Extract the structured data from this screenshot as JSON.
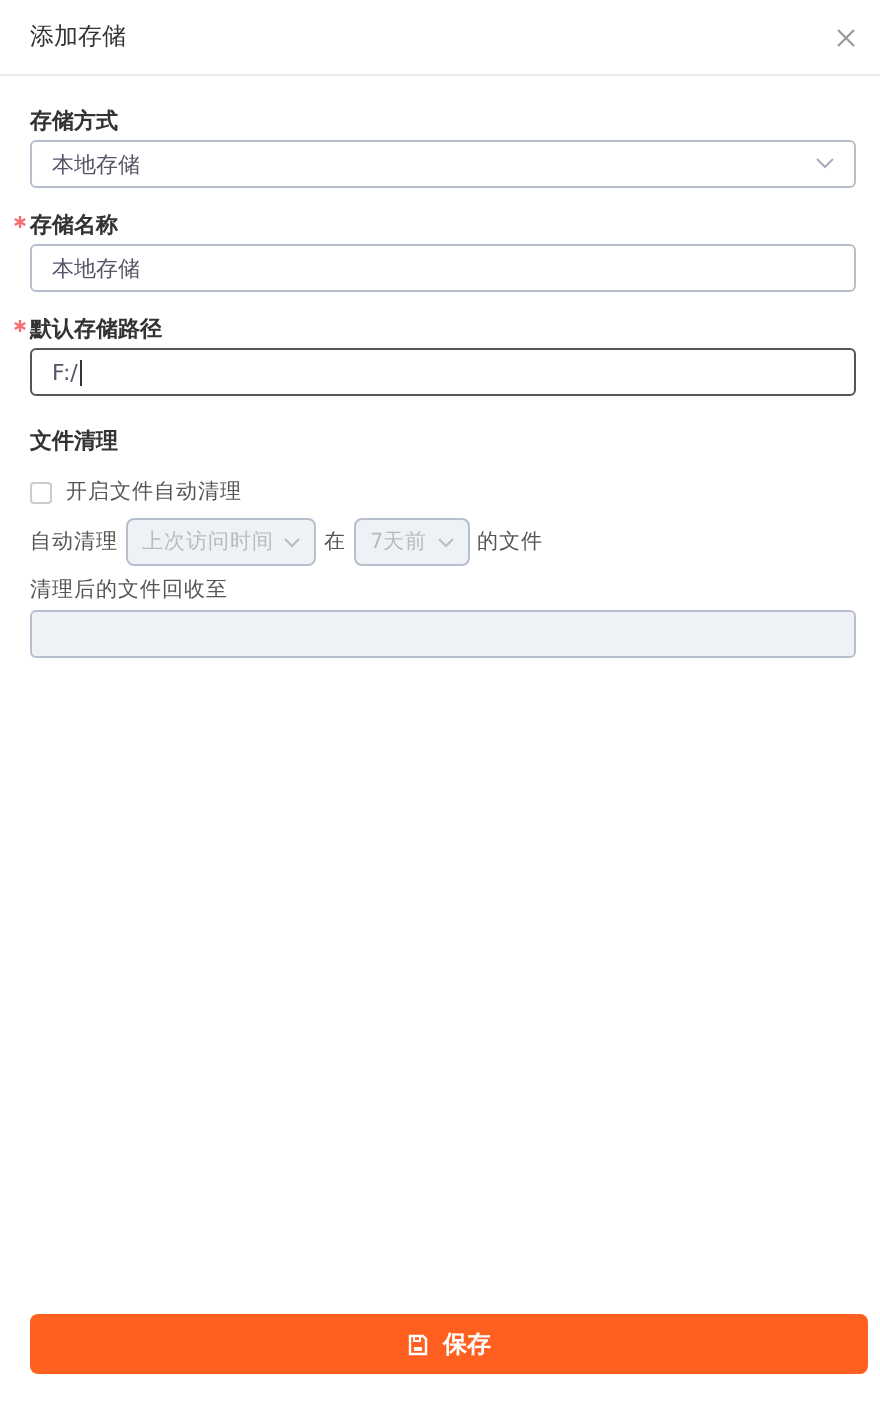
{
  "dialog": {
    "title": "添加存储"
  },
  "fields": [
    {
      "kind": "select",
      "label": "存储方式",
      "required": false,
      "value": "本地存储",
      "focused": false
    },
    {
      "kind": "input",
      "label": "存储名称",
      "required": true,
      "value": "本地存储",
      "focused": false
    },
    {
      "kind": "input",
      "label": "默认存储路径",
      "required": true,
      "value": "F:/",
      "focused": true
    }
  ],
  "cleanup": {
    "title": "文件清理",
    "checkbox": {
      "label": "开启文件自动清理",
      "checked": false
    },
    "rule": {
      "prefix": "自动清理",
      "time_select": "上次访问时间",
      "middle": "在",
      "age_select": "7天前",
      "suffix": "的文件",
      "disabled": true
    },
    "target_label": "清理后的文件回收至",
    "target_disabled": true
  },
  "save_button": {
    "label": "保存"
  }
}
